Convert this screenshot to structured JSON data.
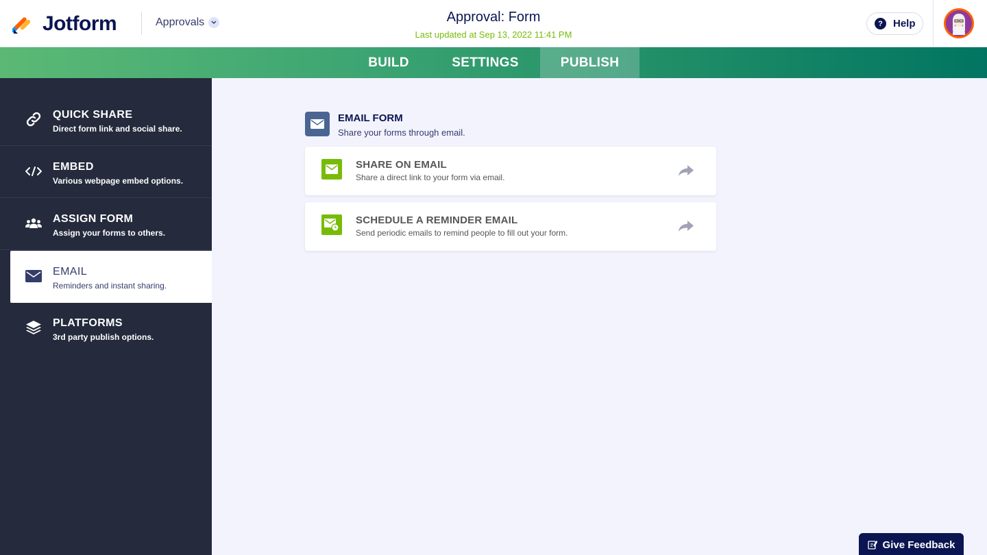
{
  "app": {
    "brand": "Jotform",
    "product_menu": "Approvals",
    "form_title": "Approval: Form",
    "last_updated": "Last updated at Sep 13, 2022 11:41 PM",
    "help_label": "Help"
  },
  "tabs": [
    {
      "label": "BUILD",
      "active": false
    },
    {
      "label": "SETTINGS",
      "active": false
    },
    {
      "label": "PUBLISH",
      "active": true
    }
  ],
  "sidebar": {
    "items": [
      {
        "label": "QUICK SHARE",
        "desc": "Direct form link and social share.",
        "icon": "link-icon",
        "active": false
      },
      {
        "label": "EMBED",
        "desc": "Various webpage embed options.",
        "icon": "code-icon",
        "active": false
      },
      {
        "label": "ASSIGN FORM",
        "desc": "Assign your forms to others.",
        "icon": "users-icon",
        "active": false
      },
      {
        "label": "EMAIL",
        "desc": "Reminders and instant sharing.",
        "icon": "envelope-icon",
        "active": true
      },
      {
        "label": "PLATFORMS",
        "desc": "3rd party publish options.",
        "icon": "layers-icon",
        "active": false
      }
    ]
  },
  "main": {
    "section_title": "EMAIL FORM",
    "section_desc": "Share your forms through email.",
    "cards": [
      {
        "title": "SHARE ON EMAIL",
        "desc": "Share a direct link to your form via email.",
        "icon": "envelope-icon"
      },
      {
        "title": "SCHEDULE A REMINDER EMAIL",
        "desc": "Send periodic emails to remind people to fill out your form.",
        "icon": "envelope-clock-icon"
      }
    ]
  },
  "feedback": {
    "label": "Give Feedback"
  },
  "colors": {
    "navy": "#0a1551",
    "accent_green": "#78bb07",
    "sidebar_bg": "#252a3c",
    "canvas_bg": "#f3f3fe"
  }
}
